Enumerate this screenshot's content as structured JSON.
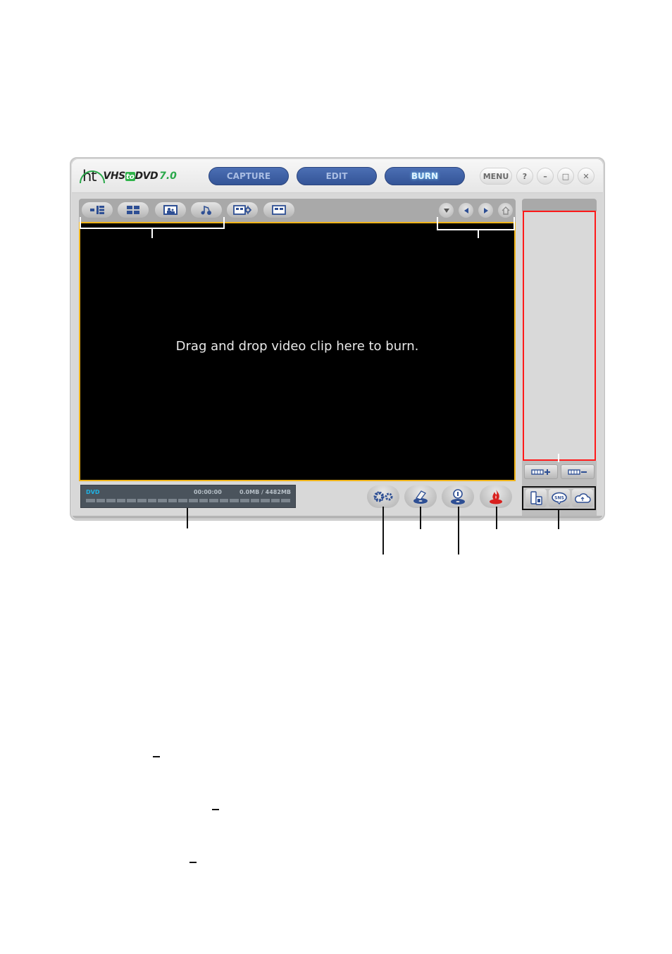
{
  "app": {
    "logo_brand": "ht",
    "logo_name_prefix": "VHS",
    "logo_name_to": "to",
    "logo_name_suffix": "DVD",
    "logo_version": "7.0"
  },
  "mode_tabs": [
    {
      "label": "CAPTURE",
      "active": false
    },
    {
      "label": "EDIT",
      "active": false
    },
    {
      "label": "BURN",
      "active": true
    }
  ],
  "window_controls": {
    "menu_label": "MENU",
    "help_label": "?",
    "minimize_label": "–",
    "maximize_label": "□",
    "close_label": "✕"
  },
  "toolbar": {
    "left_tools": [
      {
        "icon": "menu-layout-icon"
      },
      {
        "icon": "menu-template-icon"
      },
      {
        "icon": "background-image-icon"
      },
      {
        "icon": "background-music-icon"
      },
      {
        "icon": "menu-settings-icon"
      },
      {
        "icon": "chapter-menu-icon"
      }
    ],
    "nav_tools": [
      {
        "icon": "dropdown-arrow-icon"
      },
      {
        "icon": "previous-arrow-icon"
      },
      {
        "icon": "next-arrow-icon"
      },
      {
        "icon": "home-icon"
      }
    ]
  },
  "preview": {
    "message": "Drag and drop video clip here to burn."
  },
  "status": {
    "disc_type": "DVD",
    "duration": "00:00:00",
    "size": "0.0MB / 4482MB",
    "usage_percent": 0
  },
  "actions": [
    {
      "icon": "settings-gears-icon"
    },
    {
      "icon": "erase-disc-icon"
    },
    {
      "icon": "disc-info-icon"
    },
    {
      "icon": "burn-flame-icon"
    }
  ],
  "side_panel": {
    "add_label": "+",
    "remove_label": "–",
    "share": [
      {
        "icon": "device-export-icon"
      },
      {
        "icon": "sns-share-icon",
        "label": "SNS"
      },
      {
        "icon": "cloud-upload-icon"
      }
    ]
  },
  "colors": {
    "accent_blue": "#345497",
    "preview_border": "#f0b419",
    "list_border": "#ff1a1a",
    "status_label": "#1fb3e6",
    "burn_red": "#d8201e"
  }
}
